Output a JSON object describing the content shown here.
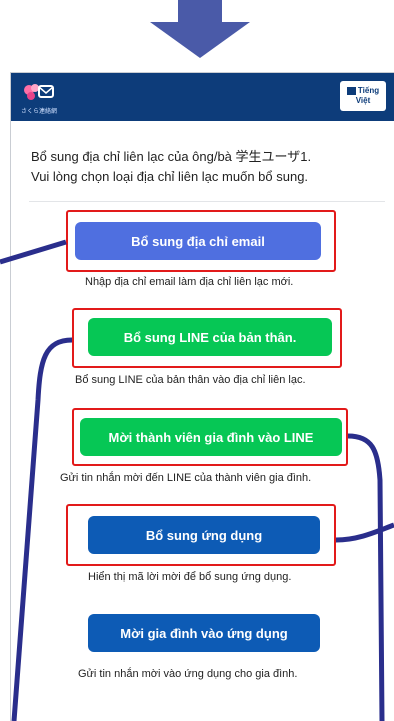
{
  "header": {
    "logo_text": "さくら連絡網",
    "lang_button_line1": "Tiếng",
    "lang_button_line2": "Việt"
  },
  "intro": {
    "line1": "Bổ sung địa chỉ liên lạc của ông/bà 学生ユーザ1.",
    "line2": "Vui lòng chọn loại địa chỉ liên lạc muốn bổ sung."
  },
  "options": [
    {
      "button": "Bổ sung địa chỉ email",
      "desc": "Nhập địa chỉ email làm địa chỉ liên lạc mới.",
      "color": "#4f6fe0"
    },
    {
      "button": "Bổ sung LINE của bản thân.",
      "desc": "Bổ sung LINE của bản thân vào địa chỉ liên lạc.",
      "color": "#06c755"
    },
    {
      "button": "Mời thành viên gia đình vào LINE",
      "desc": "Gửi tin nhắn mời đến LINE của thành viên gia đình.",
      "color": "#06c755"
    },
    {
      "button": "Bổ sung ứng dụng",
      "desc": "Hiển thị mã lời mời để bổ sung ứng dụng.",
      "color": "#0d5bb5"
    },
    {
      "button": "Mời gia đình vào ứng dụng",
      "desc": "Gửi tin nhắn mời vào ứng dụng cho gia đình.",
      "color": "#0d5bb5"
    }
  ],
  "colors": {
    "appbar": "#0d3c7a",
    "highlight": "#e21a1a",
    "annotation_line": "#2a2e8c"
  }
}
